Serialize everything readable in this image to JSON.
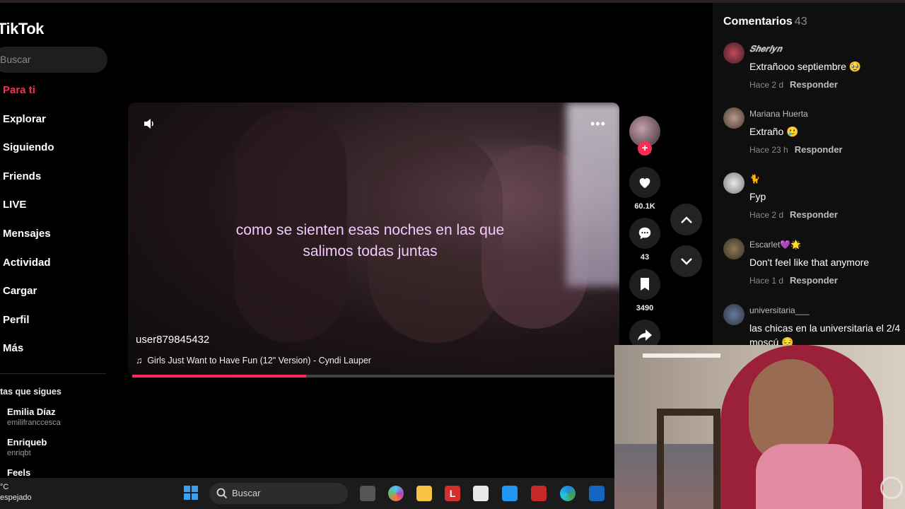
{
  "sidebar": {
    "logo": "TikTok",
    "search_placeholder": "Buscar",
    "nav": [
      "Para ti",
      "Explorar",
      "Siguiendo",
      "Friends",
      "LIVE",
      "Mensajes",
      "Actividad",
      "Cargar",
      "Perfil",
      "Más"
    ],
    "following_title": "tas que sigues",
    "accounts": [
      {
        "name": "Emilia Díaz",
        "handle": "emilifranccesca"
      },
      {
        "name": "Enriqueb",
        "handle": "enriqbt"
      },
      {
        "name": "Feels",
        "handle": ""
      }
    ]
  },
  "video": {
    "caption": "como se sienten esas noches en las que salimos todas juntas",
    "author": "user879845432",
    "music": "Girls Just Want to Have Fun (12\" Version) - Cyndi Lauper",
    "progress": 0.36
  },
  "actions": {
    "likes": "60.1K",
    "comments": "43",
    "saves": "3490"
  },
  "comments_panel": {
    "title": "Comentarios",
    "count": "43",
    "items": [
      {
        "user": "𝑺𝒉𝒆𝒓𝒍𝒚𝒏",
        "text": "Extrañooo septiembre 🥹",
        "time": "Hace 2 d",
        "reply": "Responder"
      },
      {
        "user": "Mariana Huerta",
        "text": "Extraño 🥲",
        "time": "Hace 23 h",
        "reply": "Responder"
      },
      {
        "user": "🐈",
        "text": "Fyp",
        "time": "Hace 2 d",
        "reply": "Responder"
      },
      {
        "user": "Escarlet💜🌟",
        "text": "Don't feel like that anymore",
        "time": "Hace 1 d",
        "reply": "Responder"
      },
      {
        "user": "universitaria___",
        "text": "las chicas en la universitaria el 2/4 moscú 😔",
        "time": "",
        "reply": ""
      }
    ]
  },
  "taskbar": {
    "temp": "°C",
    "weather": "espejado",
    "search": "Buscar"
  },
  "colors": {
    "accent": "#fe2c55",
    "caption": "#f2c9ff"
  }
}
